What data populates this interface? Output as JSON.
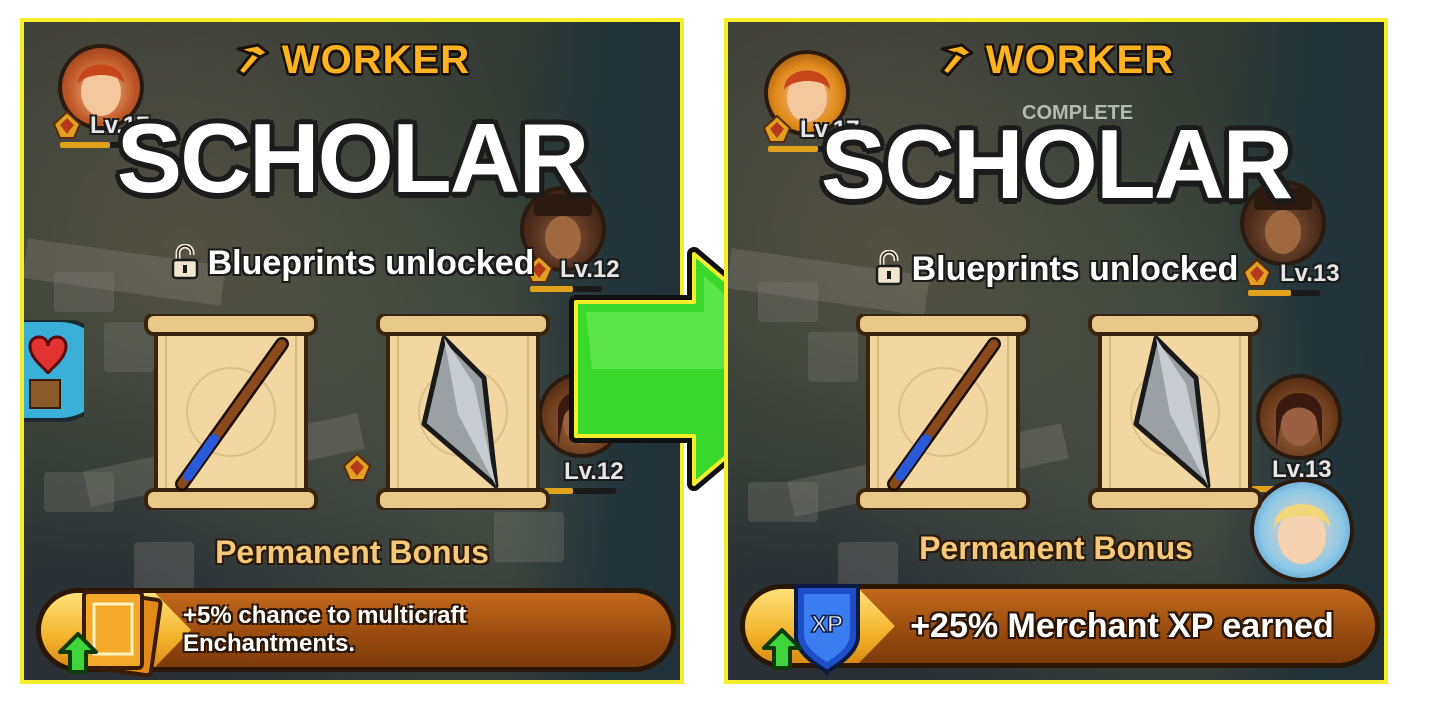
{
  "colors": {
    "frame": "#f5ee2a",
    "worker_orange": "#ffb320",
    "bonus_text": "#f6c97a",
    "bar_brown": "#9a4d10",
    "arrow_green": "#39d82a"
  },
  "panels": [
    {
      "worker_label": "WORKER",
      "class_name": "SCHOLAR",
      "unlocked_label": "Blueprints unlocked",
      "blueprints": [
        "wand-blueprint",
        "crystal-blueprint"
      ],
      "bonus_label": "Permanent Bonus",
      "bonus_text": "+5% chance to multicraft Enchantments.",
      "bonus_icon": "blueprint-stack-icon",
      "avatars": [
        {
          "level": "Lv.17",
          "progress": 0.7
        },
        {
          "level": "Lv.12",
          "progress": 0.6
        },
        {
          "level": "Lv.12",
          "progress": 0.4
        }
      ]
    },
    {
      "worker_label": "WORKER",
      "class_name": "SCHOLAR",
      "unlocked_label": "Blueprints unlocked",
      "blueprints": [
        "wand-blueprint",
        "crystal-blueprint"
      ],
      "bonus_label": "Permanent Bonus",
      "bonus_text": "+25% Merchant XP earned",
      "bonus_icon": "xp-shield-icon",
      "status_label": "COMPLETE",
      "avatars": [
        {
          "level": "Lv.17",
          "progress": 0.7
        },
        {
          "level": "Lv.13",
          "progress": 0.6
        },
        {
          "level": "Lv.13",
          "progress": 0.4
        }
      ]
    }
  ],
  "transition_icon": "green-arrow-right-icon"
}
